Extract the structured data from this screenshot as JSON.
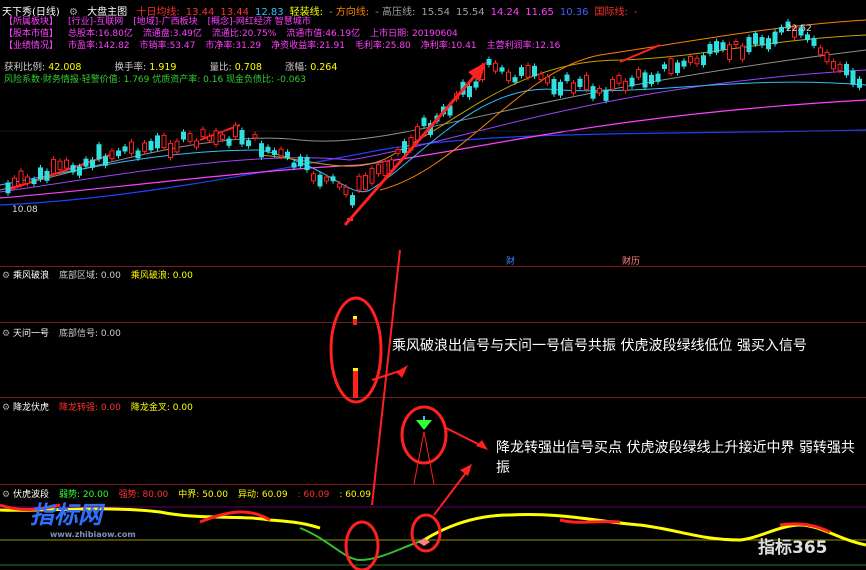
{
  "title": {
    "app": "天下秀(日线)",
    "main": "大盘主图"
  },
  "ma_bar": [
    {
      "text": "十日均线:",
      "color": "#ff3030"
    },
    {
      "text": "13.44",
      "color": "#ff3030"
    },
    {
      "text": "13.44",
      "color": "#ff3030"
    },
    {
      "text": "12.83",
      "color": "#30c0ff"
    },
    {
      "text": "轻装线:",
      "color": "#ffff00"
    },
    {
      "text": "- 方向线:",
      "color": "#ff8000"
    },
    {
      "text": "-  高压线:",
      "color": "#a0a0a0"
    },
    {
      "text": "15.54",
      "color": "#a0a0a0"
    },
    {
      "text": "15.54",
      "color": "#a0a0a0"
    },
    {
      "text": "14.24",
      "color": "#ff40ff"
    },
    {
      "text": "11.65",
      "color": "#ff40ff"
    },
    {
      "text": "10.36",
      "color": "#4060ff"
    },
    {
      "text": "国际线:",
      "color": "#ff3030"
    },
    {
      "text": "-",
      "color": "#ff3030"
    }
  ],
  "info_rows": [
    [
      "【所属板块】",
      "[行业]-互联网",
      "[地域]-广西板块",
      "[概念]-网红经济 智慧城市"
    ],
    [
      "【股本市值】",
      "总股本:16.80亿",
      "流通盘:3.49亿",
      "流通比:20.75%",
      "流通市值:46.19亿",
      "上市日期: 20190604"
    ],
    [
      "【业绩情况】",
      "市盈率:142.82",
      "市销率:53.47",
      "市净率:31.29",
      "净资收益率:21.91",
      "毛利率:25.80",
      "净利率:10.41",
      "主营利润率:12.16"
    ]
  ],
  "stats": {
    "profit_ratio_label": "获利比例:",
    "profit_ratio": "42.008",
    "turnover_label": "换手率:",
    "turnover": "1.919",
    "volume_ratio_label": "量比:",
    "volume_ratio": "0.708",
    "change_label": "涨幅:",
    "change": "0.264"
  },
  "risk_line": "风险系数·财务情报·轻警价值: 1.769 优质资产率: 0.16 现金负债比: -0.063",
  "price_labels": {
    "high": "22.52",
    "low": "10.08"
  },
  "chart_markers": {
    "fin": "财",
    "calendar": "财历"
  },
  "panels": [
    {
      "name": "乘风破浪",
      "items": [
        {
          "text": "底部区域: 0.00",
          "color": "#cccccc"
        },
        {
          "text": "乘风破浪: 0.00",
          "color": "#ffff00"
        }
      ]
    },
    {
      "name": "天问一号",
      "items": [
        {
          "text": "底部信号: 0.00",
          "color": "#cccccc"
        }
      ]
    },
    {
      "name": "降龙伏虎",
      "items": [
        {
          "text": "降龙转强: 0.00",
          "color": "#ff3030"
        },
        {
          "text": "降龙金叉: 0.00",
          "color": "#ffff00"
        }
      ]
    },
    {
      "name": "伏虎波段",
      "items": [
        {
          "text": "弱势: 20.00",
          "color": "#30ff30"
        },
        {
          "text": "强势: 80.00",
          "color": "#ff3030"
        },
        {
          "text": "中界: 50.00",
          "color": "#ffff00"
        },
        {
          "text": "异动: 60.09",
          "color": "#ffff00"
        },
        {
          "text": ": 60.09",
          "color": "#ff3030"
        },
        {
          "text": ": 60.09",
          "color": "#ffff00"
        }
      ]
    }
  ],
  "annotations": {
    "first": "乘风破浪出信号与天问一号信号共振 伏虎波段绿线低位 强买入信号",
    "second": "降龙转强出信号买点 伏虎波段绿线上升接近中界 弱转强共振"
  },
  "watermarks": {
    "left": "指标网",
    "left_url": "www.zhibiaow.com",
    "right": "指标365"
  }
}
